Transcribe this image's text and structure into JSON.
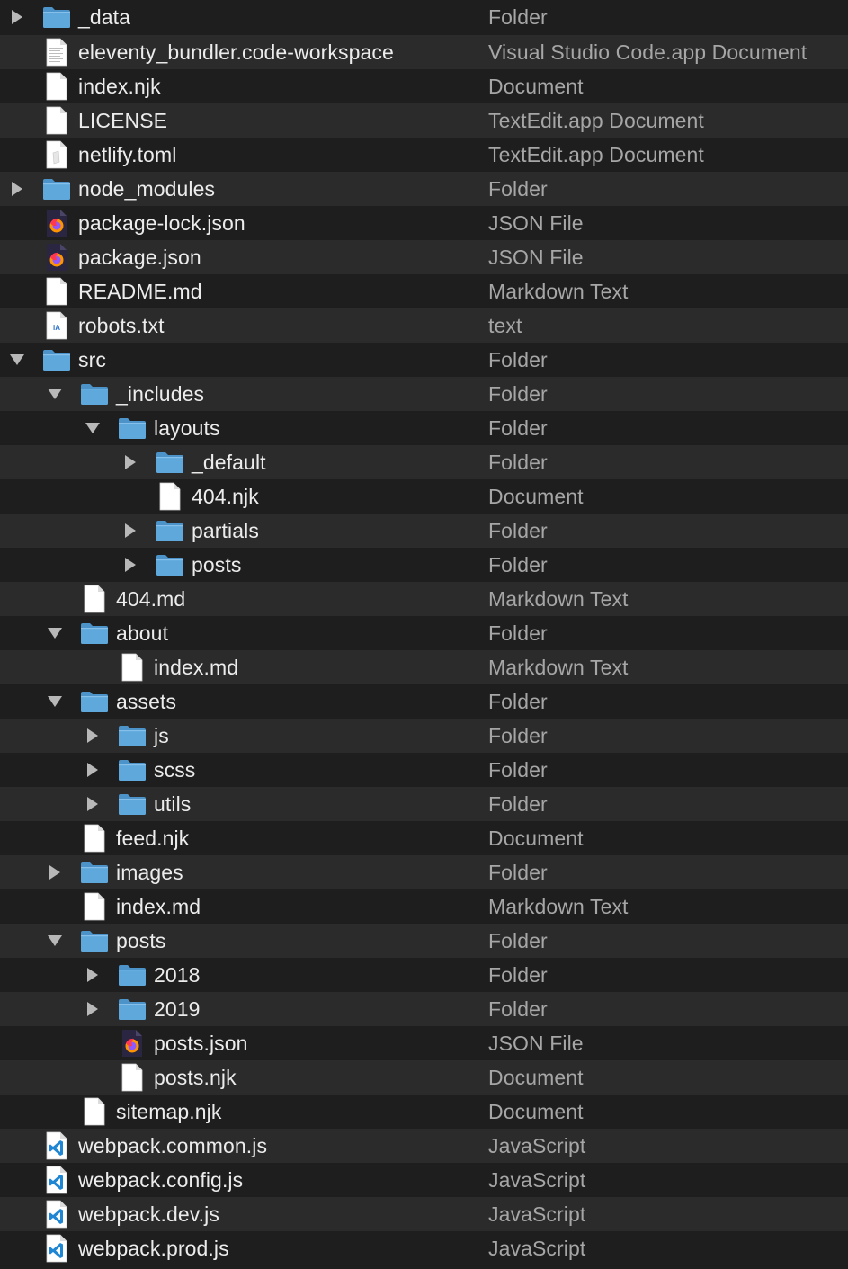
{
  "window": {
    "view": "list"
  },
  "colors": {
    "background": "#1e1e1e",
    "row_alt": "#2b2b2b",
    "name_text": "#ececec",
    "kind_text": "#a6a6a6",
    "folder_blue": "#5fa8dc"
  },
  "files": [
    {
      "name": "_data",
      "kind": "Folder",
      "depth": 0,
      "icon": "folder-icon",
      "disclosure": "collapsed"
    },
    {
      "name": "eleventy_bundler.code-workspace",
      "kind": "Visual Studio Code.app Document",
      "depth": 0,
      "icon": "text-document-icon",
      "disclosure": "none"
    },
    {
      "name": "index.njk",
      "kind": "Document",
      "depth": 0,
      "icon": "document-icon",
      "disclosure": "none"
    },
    {
      "name": "LICENSE",
      "kind": "TextEdit.app Document",
      "depth": 0,
      "icon": "document-icon",
      "disclosure": "none"
    },
    {
      "name": "netlify.toml",
      "kind": "TextEdit.app Document",
      "depth": 0,
      "icon": "textedit-document-icon",
      "disclosure": "none"
    },
    {
      "name": "node_modules",
      "kind": "Folder",
      "depth": 0,
      "icon": "folder-icon",
      "disclosure": "collapsed"
    },
    {
      "name": "package-lock.json",
      "kind": "JSON File",
      "depth": 0,
      "icon": "firefox-json-icon",
      "disclosure": "none"
    },
    {
      "name": "package.json",
      "kind": "JSON File",
      "depth": 0,
      "icon": "firefox-json-icon",
      "disclosure": "none"
    },
    {
      "name": "README.md",
      "kind": "Markdown Text",
      "depth": 0,
      "icon": "document-icon",
      "disclosure": "none"
    },
    {
      "name": "robots.txt",
      "kind": "text",
      "depth": 0,
      "icon": "ia-writer-text-icon",
      "disclosure": "none"
    },
    {
      "name": "src",
      "kind": "Folder",
      "depth": 0,
      "icon": "folder-icon",
      "disclosure": "expanded"
    },
    {
      "name": "_includes",
      "kind": "Folder",
      "depth": 1,
      "icon": "folder-icon",
      "disclosure": "expanded"
    },
    {
      "name": "layouts",
      "kind": "Folder",
      "depth": 2,
      "icon": "folder-icon",
      "disclosure": "expanded"
    },
    {
      "name": "_default",
      "kind": "Folder",
      "depth": 3,
      "icon": "folder-icon",
      "disclosure": "collapsed"
    },
    {
      "name": "404.njk",
      "kind": "Document",
      "depth": 3,
      "icon": "document-icon",
      "disclosure": "none"
    },
    {
      "name": "partials",
      "kind": "Folder",
      "depth": 3,
      "icon": "folder-icon",
      "disclosure": "collapsed"
    },
    {
      "name": "posts",
      "kind": "Folder",
      "depth": 3,
      "icon": "folder-icon",
      "disclosure": "collapsed"
    },
    {
      "name": "404.md",
      "kind": "Markdown Text",
      "depth": 1,
      "icon": "document-icon",
      "disclosure": "none"
    },
    {
      "name": "about",
      "kind": "Folder",
      "depth": 1,
      "icon": "folder-icon",
      "disclosure": "expanded"
    },
    {
      "name": "index.md",
      "kind": "Markdown Text",
      "depth": 2,
      "icon": "document-icon",
      "disclosure": "none"
    },
    {
      "name": "assets",
      "kind": "Folder",
      "depth": 1,
      "icon": "folder-icon",
      "disclosure": "expanded"
    },
    {
      "name": "js",
      "kind": "Folder",
      "depth": 2,
      "icon": "folder-icon",
      "disclosure": "collapsed"
    },
    {
      "name": "scss",
      "kind": "Folder",
      "depth": 2,
      "icon": "folder-icon",
      "disclosure": "collapsed"
    },
    {
      "name": "utils",
      "kind": "Folder",
      "depth": 2,
      "icon": "folder-icon",
      "disclosure": "collapsed"
    },
    {
      "name": "feed.njk",
      "kind": "Document",
      "depth": 1,
      "icon": "document-icon",
      "disclosure": "none"
    },
    {
      "name": "images",
      "kind": "Folder",
      "depth": 1,
      "icon": "folder-icon",
      "disclosure": "collapsed"
    },
    {
      "name": "index.md",
      "kind": "Markdown Text",
      "depth": 1,
      "icon": "document-icon",
      "disclosure": "none"
    },
    {
      "name": "posts",
      "kind": "Folder",
      "depth": 1,
      "icon": "folder-icon",
      "disclosure": "expanded"
    },
    {
      "name": "2018",
      "kind": "Folder",
      "depth": 2,
      "icon": "folder-icon",
      "disclosure": "collapsed"
    },
    {
      "name": "2019",
      "kind": "Folder",
      "depth": 2,
      "icon": "folder-icon",
      "disclosure": "collapsed"
    },
    {
      "name": "posts.json",
      "kind": "JSON File",
      "depth": 2,
      "icon": "firefox-json-icon",
      "disclosure": "none"
    },
    {
      "name": "posts.njk",
      "kind": "Document",
      "depth": 2,
      "icon": "document-icon",
      "disclosure": "none"
    },
    {
      "name": "sitemap.njk",
      "kind": "Document",
      "depth": 1,
      "icon": "document-icon",
      "disclosure": "none"
    },
    {
      "name": "webpack.common.js",
      "kind": "JavaScript",
      "depth": 0,
      "icon": "vscode-js-icon",
      "disclosure": "none"
    },
    {
      "name": "webpack.config.js",
      "kind": "JavaScript",
      "depth": 0,
      "icon": "vscode-js-icon",
      "disclosure": "none"
    },
    {
      "name": "webpack.dev.js",
      "kind": "JavaScript",
      "depth": 0,
      "icon": "vscode-js-icon",
      "disclosure": "none"
    },
    {
      "name": "webpack.prod.js",
      "kind": "JavaScript",
      "depth": 0,
      "icon": "vscode-js-icon",
      "disclosure": "none"
    }
  ]
}
